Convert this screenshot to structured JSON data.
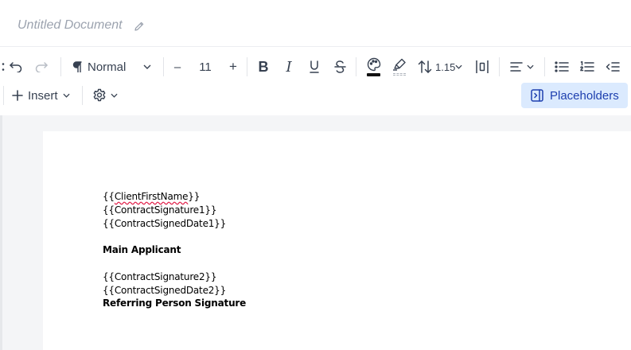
{
  "document": {
    "title": "Untitled Document"
  },
  "toolbar": {
    "style_label": "Normal",
    "font_size": "11",
    "decrease_label": "–",
    "increase_label": "+",
    "line_height": "1.15",
    "insert_label": "Insert",
    "placeholders_label": "Placeholders",
    "text_color": "#111111"
  },
  "page": {
    "lines": [
      "{{ClientFirstName}}",
      "{{ContractSignature1}}",
      "{{ContractSignedDate1}}",
      "",
      "Main Applicant",
      "",
      "{{ContractSignature2}}",
      "{{ContractSignedDate2}}",
      "Referring Person Signature"
    ]
  }
}
